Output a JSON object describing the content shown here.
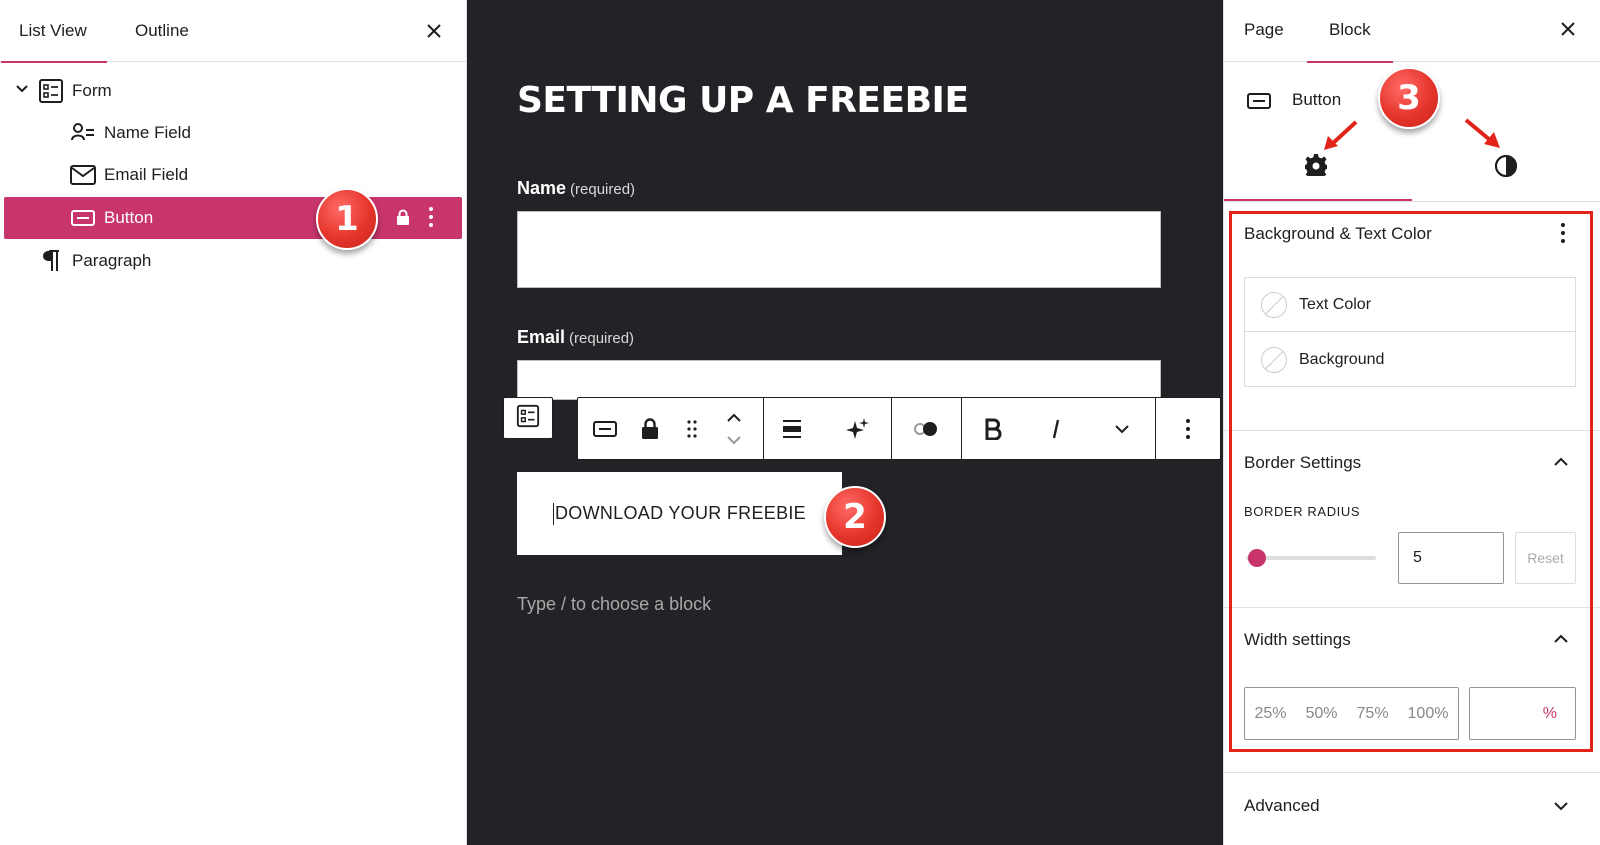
{
  "left_panel": {
    "tabs": [
      "List View",
      "Outline"
    ],
    "tree": [
      {
        "label": "Form",
        "icon": "form-icon"
      },
      {
        "label": "Name Field",
        "icon": "name-field-icon"
      },
      {
        "label": "Email Field",
        "icon": "envelope-icon"
      },
      {
        "label": "Button",
        "icon": "button-icon"
      },
      {
        "label": "Paragraph",
        "icon": "pilcrow-icon"
      }
    ]
  },
  "canvas": {
    "heading": "SETTING UP A FREEBIE",
    "fields": [
      {
        "label": "Name",
        "hint": "(required)"
      },
      {
        "label": "Email",
        "hint": "(required)"
      }
    ],
    "button_text": "DOWNLOAD YOUR FREEBIE",
    "placeholder": "Type / to choose a block",
    "toolbar_icons": [
      "button-icon",
      "lock-icon",
      "drag-handle-icon",
      "move-up-down-icon",
      "align-icon",
      "sparkles-icon",
      "toggle-icon",
      "bold-icon",
      "italic-icon",
      "more-formatting-icon",
      "options-icon"
    ]
  },
  "right_panel": {
    "tabs": [
      "Page",
      "Block"
    ],
    "block_name": "Button",
    "sections": {
      "colors": {
        "title": "Background & Text Color",
        "items": [
          "Text Color",
          "Background"
        ]
      },
      "border": {
        "title": "Border Settings",
        "radius_label": "BORDER RADIUS",
        "radius_value": "5",
        "reset_label": "Reset",
        "radius_fraction": 0.05
      },
      "width": {
        "title": "Width settings",
        "options": [
          "25%",
          "50%",
          "75%",
          "100%"
        ],
        "unit": "%"
      },
      "advanced": {
        "title": "Advanced"
      }
    }
  },
  "callouts": [
    "1",
    "2",
    "3"
  ],
  "colors": {
    "accent": "#c8346c",
    "canvas_bg": "#232327",
    "callout": "#e5352b",
    "highlight_frame": "#e2231a"
  }
}
